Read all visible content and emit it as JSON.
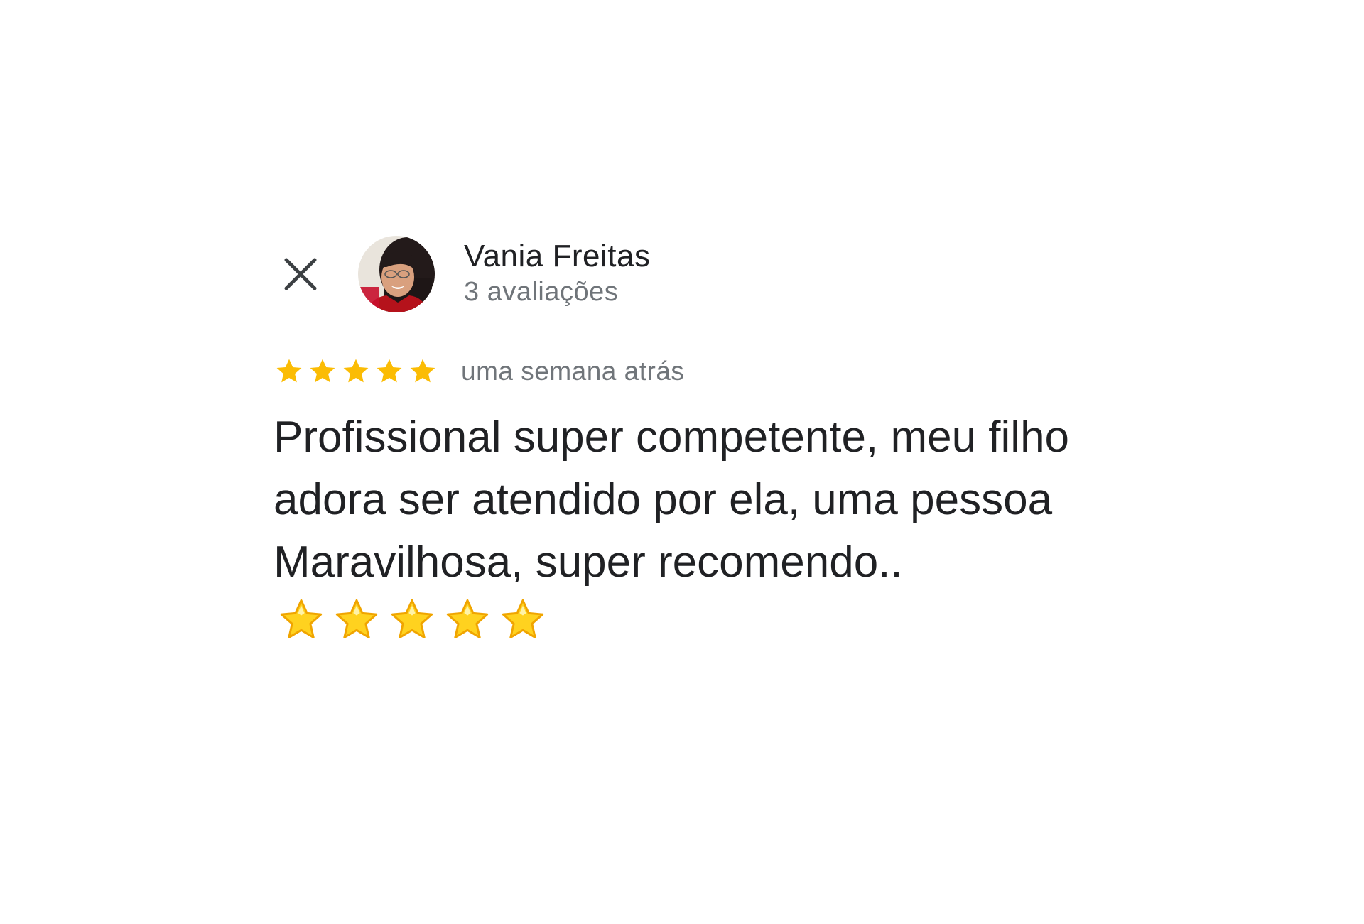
{
  "reviewer": {
    "name": "Vania Freitas",
    "review_count_text": "3 avaliações"
  },
  "review": {
    "rating": 5,
    "max_rating": 5,
    "time_ago": "uma semana atrás",
    "text": "Profissional super competente,  meu filho adora ser atendido por ela, uma pessoa Maravilhosa, super recomendo..",
    "trailing_emoji": "⭐⭐⭐⭐⭐"
  },
  "icons": {
    "close": "close-icon",
    "star": "star-icon",
    "avatar": "profile-photo"
  },
  "colors": {
    "star": "#fbbc04",
    "name": "#202124",
    "secondary": "#70757a"
  }
}
